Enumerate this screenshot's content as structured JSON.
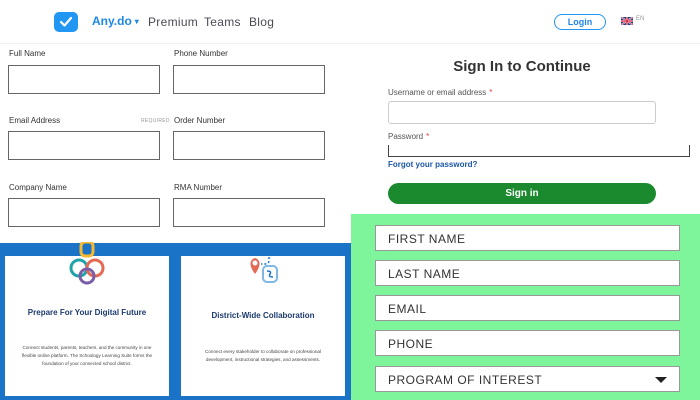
{
  "nav": {
    "brand": "Any.do",
    "links": [
      "Premium",
      "Teams",
      "Blog"
    ],
    "login_label": "Login",
    "lang_code": "EN",
    "brand_color": "#1e88e5"
  },
  "order_form": {
    "fields": [
      {
        "label": "Full Name",
        "value": ""
      },
      {
        "label": "Phone Number",
        "value": ""
      },
      {
        "label": "Email Address",
        "value": "",
        "note": "REQUIRED"
      },
      {
        "label": "Order Number",
        "value": ""
      },
      {
        "label": "Company Name",
        "value": ""
      },
      {
        "label": "RMA Number",
        "value": ""
      }
    ]
  },
  "signin": {
    "title": "Sign In to Continue",
    "username_label": "Username or email address",
    "password_label": "Password",
    "required_mark": "*",
    "forgot_label": "Forgot your password?",
    "button_label": "Sign in",
    "button_color": "#1b8a2f",
    "link_color": "#1a56a6"
  },
  "cards": [
    {
      "title": "Prepare For Your Digital Future",
      "description": "Connect students, parents, teachers, and the community in one flexible online platform. The Schoology Learning Suite forms the foundation of your connected school district.",
      "icon": "chain-links-icon"
    },
    {
      "title": "District-Wide Collaboration",
      "description": "Connect every stakeholder to collaborate on professional development, instructional strategies, and assessments.",
      "icon": "map-route-icon"
    }
  ],
  "lead_form": {
    "background": "#7ef59a",
    "fields": [
      "FIRST NAME",
      "LAST NAME",
      "EMAIL",
      "PHONE"
    ],
    "select_label": "PROGRAM OF INTEREST"
  }
}
